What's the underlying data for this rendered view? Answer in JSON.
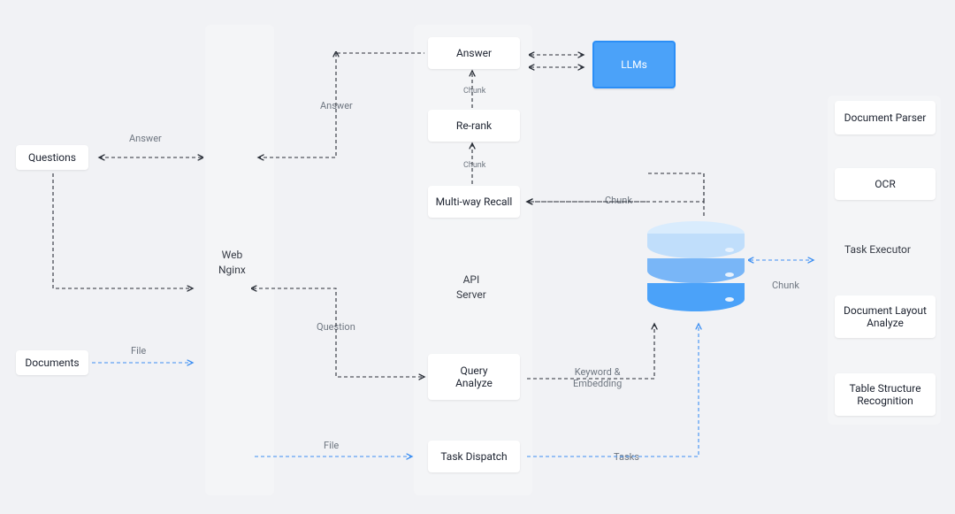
{
  "inputs": {
    "questions": "Questions",
    "documents": "Documents"
  },
  "columns": {
    "web": "Web\nNginx",
    "api": "API\nServer"
  },
  "api_nodes": {
    "answer": "Answer",
    "rerank": "Re-rank",
    "multiway": "Multi-way Recall",
    "query_analyze": "Query\nAnalyze",
    "task_dispatch": "Task Dispatch"
  },
  "right_nodes": {
    "doc_parser": "Document Parser",
    "ocr": "OCR",
    "task_executor": "Task Executor",
    "layout_analyze": "Document Layout\nAnalyze",
    "table_struct": "Table Structure\nRecognition"
  },
  "llm": "LLMs",
  "edge_labels": {
    "answer_left_top": "Answer",
    "answer_mid": "Answer",
    "question_mid": "Question",
    "file_left": "File",
    "file_mid": "File",
    "chunk_api1": "Chunk",
    "chunk_api2": "Chunk",
    "chunk_db": "Chunk",
    "chunk_right": "Chunk",
    "keyword_embedding": "Keyword &\nEmbedding",
    "tasks": "Tasks"
  }
}
